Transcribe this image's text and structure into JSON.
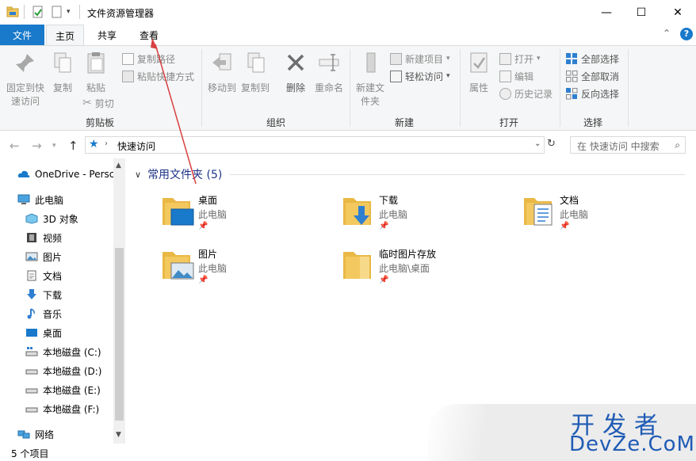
{
  "window": {
    "title": "文件资源管理器",
    "minimize": "—",
    "maximize": "☐",
    "close": "✕"
  },
  "ribbon_tabs": {
    "file": "文件",
    "home": "主页",
    "share": "共享",
    "view": "查看",
    "collapse": "⌃",
    "help": "?"
  },
  "ribbon": {
    "clipboard": {
      "pin_quick_access": "固定到快速访问",
      "copy": "复制",
      "paste": "粘贴",
      "copy_path": "复制路径",
      "paste_shortcut": "粘贴快捷方式",
      "cut": "剪切",
      "group_label": "剪贴板"
    },
    "organize": {
      "move_to": "移动到",
      "copy_to": "复制到",
      "delete": "删除",
      "rename": "重命名",
      "group_label": "组织"
    },
    "new": {
      "new_folder": "新建文件夹",
      "new_item": "新建项目",
      "easy_access": "轻松访问",
      "group_label": "新建"
    },
    "open": {
      "properties": "属性",
      "open": "打开",
      "edit": "编辑",
      "history": "历史记录",
      "group_label": "打开"
    },
    "select": {
      "select_all": "全部选择",
      "select_none": "全部取消",
      "invert": "反向选择",
      "group_label": "选择"
    }
  },
  "address": {
    "path": "快速访问",
    "search_placeholder": "在 快速访问 中搜索"
  },
  "nav": {
    "items": [
      {
        "label": "OneDrive - Persc"
      },
      {
        "label": "此电脑"
      },
      {
        "label": "3D 对象"
      },
      {
        "label": "视频"
      },
      {
        "label": "图片"
      },
      {
        "label": "文档"
      },
      {
        "label": "下载"
      },
      {
        "label": "音乐"
      },
      {
        "label": "桌面"
      },
      {
        "label": "本地磁盘 (C:)"
      },
      {
        "label": "本地磁盘 (D:)"
      },
      {
        "label": "本地磁盘 (E:)"
      },
      {
        "label": "本地磁盘 (F:)"
      },
      {
        "label": "网络"
      }
    ]
  },
  "content": {
    "group_title": "常用文件夹 (5)",
    "folders": [
      {
        "name": "桌面",
        "location": "此电脑"
      },
      {
        "name": "下载",
        "location": "此电脑"
      },
      {
        "name": "文档",
        "location": "此电脑"
      },
      {
        "name": "图片",
        "location": "此电脑"
      },
      {
        "name": "临时图片存放",
        "location": "此电脑\\桌面"
      }
    ]
  },
  "status": {
    "count": "5 个项目"
  },
  "watermark": {
    "top": "开发者",
    "bottom": "DevZe.CoM"
  },
  "colors": {
    "accent": "#1979ca",
    "folder": "#f3c85f",
    "annotation_arrow": "#d84040"
  }
}
